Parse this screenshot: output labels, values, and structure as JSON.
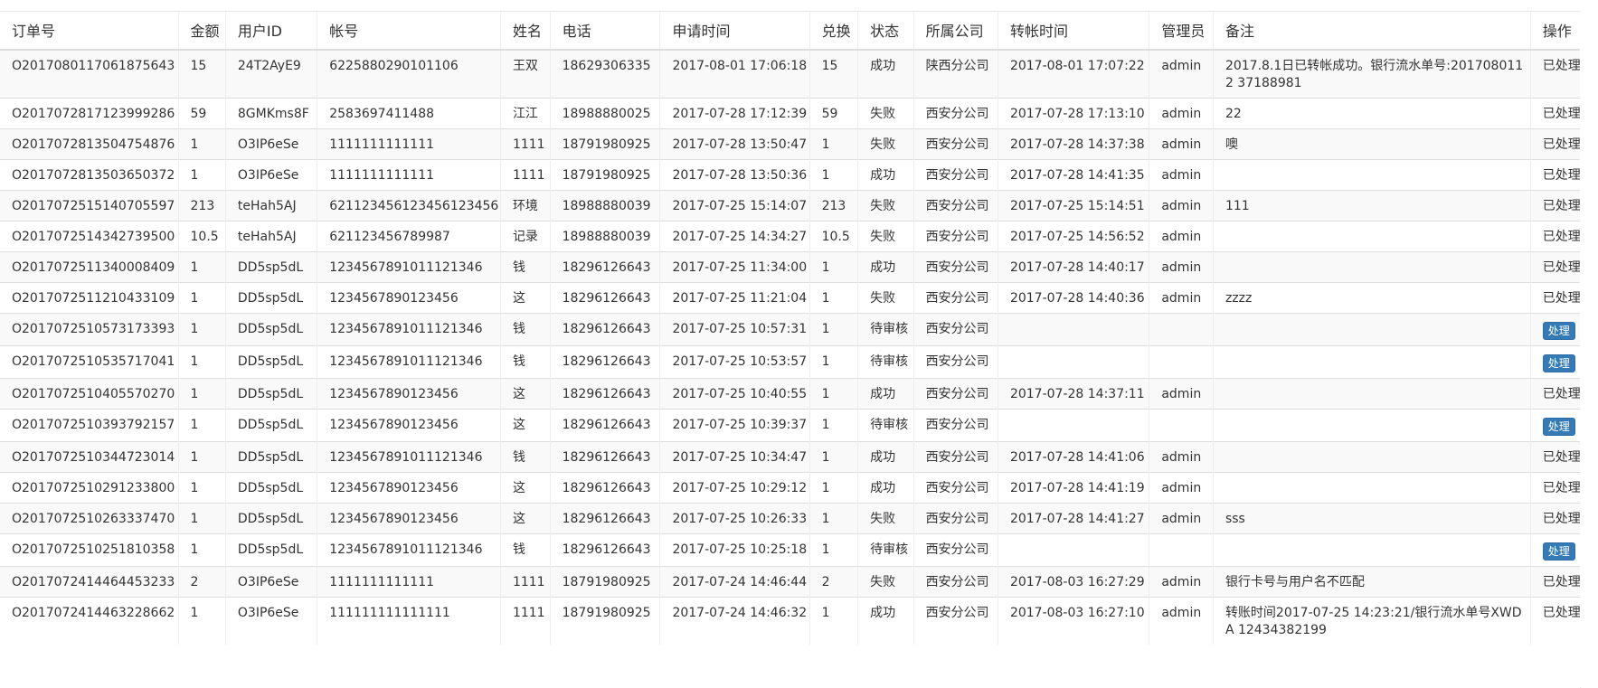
{
  "table": {
    "columns": [
      "订单号",
      "金额",
      "用户ID",
      "帐号",
      "姓名",
      "电话",
      "申请时间",
      "兑换",
      "状态",
      "所属公司",
      "转帐时间",
      "管理员",
      "备注",
      "操作"
    ],
    "process_label": "处理",
    "rows": [
      {
        "order_no": "O2017080117061875643",
        "amount": "15",
        "user_id": "24T2AyE9",
        "account": "6225880290101106",
        "name": "王双",
        "phone": "18629306335",
        "apply_time": "2017-08-01 17:06:18",
        "exchange": "15",
        "status": "成功",
        "company": "陕西分公司",
        "transfer_time": "2017-08-01 17:07:22",
        "admin": "admin",
        "note": "2017.8.1日已转帐成功。银行流水单号:2017080112 37188981",
        "action": "已处理",
        "action_type": "text"
      },
      {
        "order_no": "O2017072817123999286",
        "amount": "59",
        "user_id": "8GMKms8F",
        "account": "2583697411488",
        "name": "江江",
        "phone": "18988880025",
        "apply_time": "2017-07-28 17:12:39",
        "exchange": "59",
        "status": "失败",
        "company": "西安分公司",
        "transfer_time": "2017-07-28 17:13:10",
        "admin": "admin",
        "note": "22",
        "action": "已处理",
        "action_type": "text"
      },
      {
        "order_no": "O2017072813504754876",
        "amount": "1",
        "user_id": "O3IP6eSe",
        "account": "1111111111111",
        "name": "1111",
        "phone": "18791980925",
        "apply_time": "2017-07-28 13:50:47",
        "exchange": "1",
        "status": "失败",
        "company": "西安分公司",
        "transfer_time": "2017-07-28 14:37:38",
        "admin": "admin",
        "note": "噢",
        "action": "已处理",
        "action_type": "text"
      },
      {
        "order_no": "O2017072813503650372",
        "amount": "1",
        "user_id": "O3IP6eSe",
        "account": "1111111111111",
        "name": "1111",
        "phone": "18791980925",
        "apply_time": "2017-07-28 13:50:36",
        "exchange": "1",
        "status": "成功",
        "company": "西安分公司",
        "transfer_time": "2017-07-28 14:41:35",
        "admin": "admin",
        "note": "",
        "action": "已处理",
        "action_type": "text"
      },
      {
        "order_no": "O2017072515140705597",
        "amount": "213",
        "user_id": "teHah5AJ",
        "account": "621123456123456123456",
        "name": "环境",
        "phone": "18988880039",
        "apply_time": "2017-07-25 15:14:07",
        "exchange": "213",
        "status": "失败",
        "company": "西安分公司",
        "transfer_time": "2017-07-25 15:14:51",
        "admin": "admin",
        "note": "111",
        "action": "已处理",
        "action_type": "text"
      },
      {
        "order_no": "O2017072514342739500",
        "amount": "10.5",
        "user_id": "teHah5AJ",
        "account": "621123456789987",
        "name": "记录",
        "phone": "18988880039",
        "apply_time": "2017-07-25 14:34:27",
        "exchange": "10.5",
        "status": "失败",
        "company": "西安分公司",
        "transfer_time": "2017-07-25 14:56:52",
        "admin": "admin",
        "note": "",
        "action": "已处理",
        "action_type": "text"
      },
      {
        "order_no": "O2017072511340008409",
        "amount": "1",
        "user_id": "DD5sp5dL",
        "account": "1234567891011121346",
        "name": "钱",
        "phone": "18296126643",
        "apply_time": "2017-07-25 11:34:00",
        "exchange": "1",
        "status": "成功",
        "company": "西安分公司",
        "transfer_time": "2017-07-28 14:40:17",
        "admin": "admin",
        "note": "",
        "action": "已处理",
        "action_type": "text"
      },
      {
        "order_no": "O2017072511210433109",
        "amount": "1",
        "user_id": "DD5sp5dL",
        "account": "1234567890123456",
        "name": "这",
        "phone": "18296126643",
        "apply_time": "2017-07-25 11:21:04",
        "exchange": "1",
        "status": "失败",
        "company": "西安分公司",
        "transfer_time": "2017-07-28 14:40:36",
        "admin": "admin",
        "note": "zzzz",
        "action": "已处理",
        "action_type": "text"
      },
      {
        "order_no": "O2017072510573173393",
        "amount": "1",
        "user_id": "DD5sp5dL",
        "account": "1234567891011121346",
        "name": "钱",
        "phone": "18296126643",
        "apply_time": "2017-07-25 10:57:31",
        "exchange": "1",
        "status": "待审核",
        "company": "西安分公司",
        "transfer_time": "",
        "admin": "",
        "note": "",
        "action": "处理",
        "action_type": "button"
      },
      {
        "order_no": "O2017072510535717041",
        "amount": "1",
        "user_id": "DD5sp5dL",
        "account": "1234567891011121346",
        "name": "钱",
        "phone": "18296126643",
        "apply_time": "2017-07-25 10:53:57",
        "exchange": "1",
        "status": "待审核",
        "company": "西安分公司",
        "transfer_time": "",
        "admin": "",
        "note": "",
        "action": "处理",
        "action_type": "button"
      },
      {
        "order_no": "O2017072510405570270",
        "amount": "1",
        "user_id": "DD5sp5dL",
        "account": "1234567890123456",
        "name": "这",
        "phone": "18296126643",
        "apply_time": "2017-07-25 10:40:55",
        "exchange": "1",
        "status": "成功",
        "company": "西安分公司",
        "transfer_time": "2017-07-28 14:37:11",
        "admin": "admin",
        "note": "",
        "action": "已处理",
        "action_type": "text"
      },
      {
        "order_no": "O2017072510393792157",
        "amount": "1",
        "user_id": "DD5sp5dL",
        "account": "1234567890123456",
        "name": "这",
        "phone": "18296126643",
        "apply_time": "2017-07-25 10:39:37",
        "exchange": "1",
        "status": "待审核",
        "company": "西安分公司",
        "transfer_time": "",
        "admin": "",
        "note": "",
        "action": "处理",
        "action_type": "button"
      },
      {
        "order_no": "O2017072510344723014",
        "amount": "1",
        "user_id": "DD5sp5dL",
        "account": "1234567891011121346",
        "name": "钱",
        "phone": "18296126643",
        "apply_time": "2017-07-25 10:34:47",
        "exchange": "1",
        "status": "成功",
        "company": "西安分公司",
        "transfer_time": "2017-07-28 14:41:06",
        "admin": "admin",
        "note": "",
        "action": "已处理",
        "action_type": "text"
      },
      {
        "order_no": "O2017072510291233800",
        "amount": "1",
        "user_id": "DD5sp5dL",
        "account": "1234567890123456",
        "name": "这",
        "phone": "18296126643",
        "apply_time": "2017-07-25 10:29:12",
        "exchange": "1",
        "status": "成功",
        "company": "西安分公司",
        "transfer_time": "2017-07-28 14:41:19",
        "admin": "admin",
        "note": "",
        "action": "已处理",
        "action_type": "text"
      },
      {
        "order_no": "O2017072510263337470",
        "amount": "1",
        "user_id": "DD5sp5dL",
        "account": "1234567890123456",
        "name": "这",
        "phone": "18296126643",
        "apply_time": "2017-07-25 10:26:33",
        "exchange": "1",
        "status": "失败",
        "company": "西安分公司",
        "transfer_time": "2017-07-28 14:41:27",
        "admin": "admin",
        "note": "sss",
        "action": "已处理",
        "action_type": "text"
      },
      {
        "order_no": "O2017072510251810358",
        "amount": "1",
        "user_id": "DD5sp5dL",
        "account": "1234567891011121346",
        "name": "钱",
        "phone": "18296126643",
        "apply_time": "2017-07-25 10:25:18",
        "exchange": "1",
        "status": "待审核",
        "company": "西安分公司",
        "transfer_time": "",
        "admin": "",
        "note": "",
        "action": "处理",
        "action_type": "button"
      },
      {
        "order_no": "O2017072414464453233",
        "amount": "2",
        "user_id": "O3IP6eSe",
        "account": "1111111111111",
        "name": "1111",
        "phone": "18791980925",
        "apply_time": "2017-07-24 14:46:44",
        "exchange": "2",
        "status": "失败",
        "company": "西安分公司",
        "transfer_time": "2017-08-03 16:27:29",
        "admin": "admin",
        "note": "银行卡号与用户名不匹配",
        "action": "已处理",
        "action_type": "text"
      },
      {
        "order_no": "O2017072414463228662",
        "amount": "1",
        "user_id": "O3IP6eSe",
        "account": "111111111111111",
        "name": "1111",
        "phone": "18791980925",
        "apply_time": "2017-07-24 14:46:32",
        "exchange": "1",
        "status": "成功",
        "company": "西安分公司",
        "transfer_time": "2017-08-03 16:27:10",
        "admin": "admin",
        "note": "转账时间2017-07-25 14:23:21/银行流水单号XWDA 12434382199",
        "action": "已处理",
        "action_type": "text"
      }
    ]
  },
  "colors": {
    "button_bg": "#337ab7",
    "stripe_bg": "#f9f9f9",
    "border": "#dddddd",
    "text": "#333333"
  }
}
